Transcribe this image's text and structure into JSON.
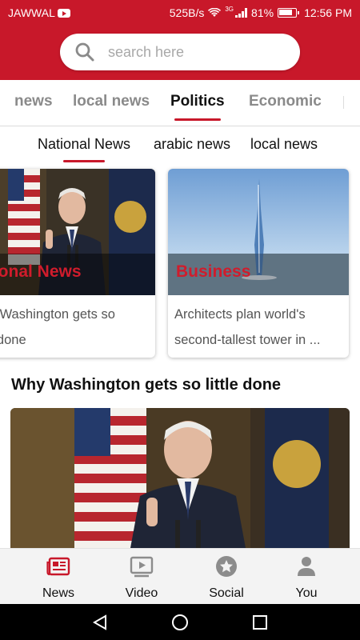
{
  "status_bar": {
    "carrier": "JAWWAL",
    "net_speed": "525B/s",
    "network_type": "3G",
    "battery": "81%",
    "time": "12:56 PM"
  },
  "search": {
    "placeholder": "search here",
    "value": ""
  },
  "category_tabs": [
    {
      "label": "news",
      "active": false
    },
    {
      "label": "local news",
      "active": false
    },
    {
      "label": "Politics",
      "active": true
    },
    {
      "label": "Economic",
      "active": false
    }
  ],
  "sub_tabs": [
    {
      "label": "National News",
      "active": true
    },
    {
      "label": "arabic news",
      "active": false
    },
    {
      "label": "local news",
      "active": false
    }
  ],
  "cards": [
    {
      "category": "National News",
      "headline": "Why Washington gets so little done"
    },
    {
      "category": "Business",
      "headline": "Architects plan world's second-tallest tower in ..."
    }
  ],
  "featured": {
    "title": "Why Washington gets so little done"
  },
  "bottom_nav": [
    {
      "label": "News",
      "icon": "newspaper-icon",
      "active": true
    },
    {
      "label": "Video",
      "icon": "video-icon",
      "active": false
    },
    {
      "label": "Social",
      "icon": "star-badge-icon",
      "active": false
    },
    {
      "label": "You",
      "icon": "person-icon",
      "active": false
    }
  ],
  "colors": {
    "brand_red": "#c8182a",
    "category_label_red": "#d01c2c",
    "inactive_tab": "#8a8a8a",
    "inactive_nav_icon": "#8c8c8c"
  }
}
